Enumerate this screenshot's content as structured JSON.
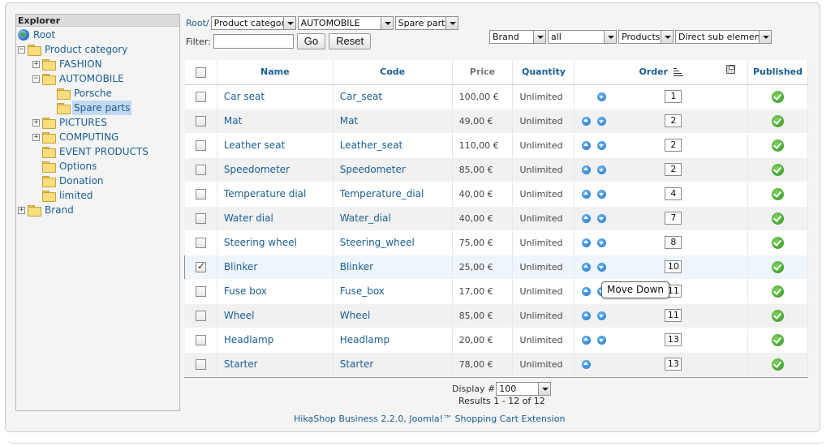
{
  "explorer": {
    "title": "Explorer",
    "nodes": [
      {
        "label": "Root",
        "icon": "globe-icon",
        "toggle": ""
      },
      {
        "label": "Product category",
        "icon": "folder-open-icon",
        "toggle": "−"
      },
      {
        "label": "FASHION",
        "icon": "folder-icon",
        "toggle": "+"
      },
      {
        "label": "AUTOMOBILE",
        "icon": "folder-open-icon",
        "toggle": "−"
      },
      {
        "label": "Porsche",
        "icon": "folder-icon",
        "toggle": ""
      },
      {
        "label": "Spare parts",
        "icon": "folder-open-icon",
        "toggle": ""
      },
      {
        "label": "PICTURES",
        "icon": "folder-icon",
        "toggle": "+"
      },
      {
        "label": "COMPUTING",
        "icon": "folder-icon",
        "toggle": "+"
      },
      {
        "label": "EVENT PRODUCTS",
        "icon": "folder-icon",
        "toggle": ""
      },
      {
        "label": "Options",
        "icon": "folder-icon",
        "toggle": ""
      },
      {
        "label": "Donation",
        "icon": "folder-icon",
        "toggle": ""
      },
      {
        "label": "limited",
        "icon": "folder-icon",
        "toggle": ""
      },
      {
        "label": "Brand",
        "icon": "folder-icon",
        "toggle": "+"
      }
    ]
  },
  "breadcrumb": {
    "root_label": "Root/",
    "selects": [
      "Product category",
      "AUTOMOBILE",
      "Spare parts"
    ]
  },
  "filter": {
    "label": "Filter:",
    "value": "",
    "go_label": "Go",
    "reset_label": "Reset"
  },
  "right_filters": [
    "Brand",
    "all",
    "Products",
    "Direct sub elements"
  ],
  "table": {
    "headers": {
      "name": "Name",
      "code": "Code",
      "price": "Price",
      "quantity": "Quantity",
      "order": "Order",
      "published": "Published"
    },
    "rows": [
      {
        "name": "Car seat",
        "code": "Car_seat",
        "price": "100,00 €",
        "quantity": "Unlimited",
        "order": "1",
        "checked": false,
        "up": false,
        "down": true
      },
      {
        "name": "Mat",
        "code": "Mat",
        "price": "49,00 €",
        "quantity": "Unlimited",
        "order": "2",
        "checked": false,
        "up": true,
        "down": true
      },
      {
        "name": "Leather seat",
        "code": "Leather_seat",
        "price": "110,00 €",
        "quantity": "Unlimited",
        "order": "2",
        "checked": false,
        "up": true,
        "down": true
      },
      {
        "name": "Speedometer",
        "code": "Speedometer",
        "price": "85,00 €",
        "quantity": "Unlimited",
        "order": "2",
        "checked": false,
        "up": true,
        "down": true
      },
      {
        "name": "Temperature dial",
        "code": "Temperature_dial",
        "price": "40,00 €",
        "quantity": "Unlimited",
        "order": "4",
        "checked": false,
        "up": true,
        "down": true
      },
      {
        "name": "Water dial",
        "code": "Water_dial",
        "price": "40,00 €",
        "quantity": "Unlimited",
        "order": "7",
        "checked": false,
        "up": true,
        "down": true
      },
      {
        "name": "Steering wheel",
        "code": "Steering_wheel",
        "price": "75,00 €",
        "quantity": "Unlimited",
        "order": "8",
        "checked": false,
        "up": true,
        "down": true
      },
      {
        "name": "Blinker",
        "code": "Blinker",
        "price": "25,00 €",
        "quantity": "Unlimited",
        "order": "10",
        "checked": true,
        "up": true,
        "down": true
      },
      {
        "name": "Fuse box",
        "code": "Fuse_box",
        "price": "17,00 €",
        "quantity": "Unlimited",
        "order": "11",
        "checked": false,
        "up": true,
        "down": true
      },
      {
        "name": "Wheel",
        "code": "Wheel",
        "price": "85,00 €",
        "quantity": "Unlimited",
        "order": "11",
        "checked": false,
        "up": true,
        "down": true
      },
      {
        "name": "Headlamp",
        "code": "Headlamp",
        "price": "20,00 €",
        "quantity": "Unlimited",
        "order": "13",
        "checked": false,
        "up": true,
        "down": true
      },
      {
        "name": "Starter",
        "code": "Starter",
        "price": "78,00 €",
        "quantity": "Unlimited",
        "order": "13",
        "checked": false,
        "up": true,
        "down": false
      }
    ]
  },
  "tooltip": "Move Down",
  "pagination": {
    "display_label": "Display #",
    "display_value": "100",
    "results": "Results 1 - 12 of 12"
  },
  "credits": "HikaShop Business 2.2.0, Joomla!™ Shopping Cart Extension",
  "colors": {
    "link": "#1a5e96",
    "selected_node": "#c3d9f0",
    "published": "#2f8f1e",
    "arrow": "#1f73c8"
  }
}
